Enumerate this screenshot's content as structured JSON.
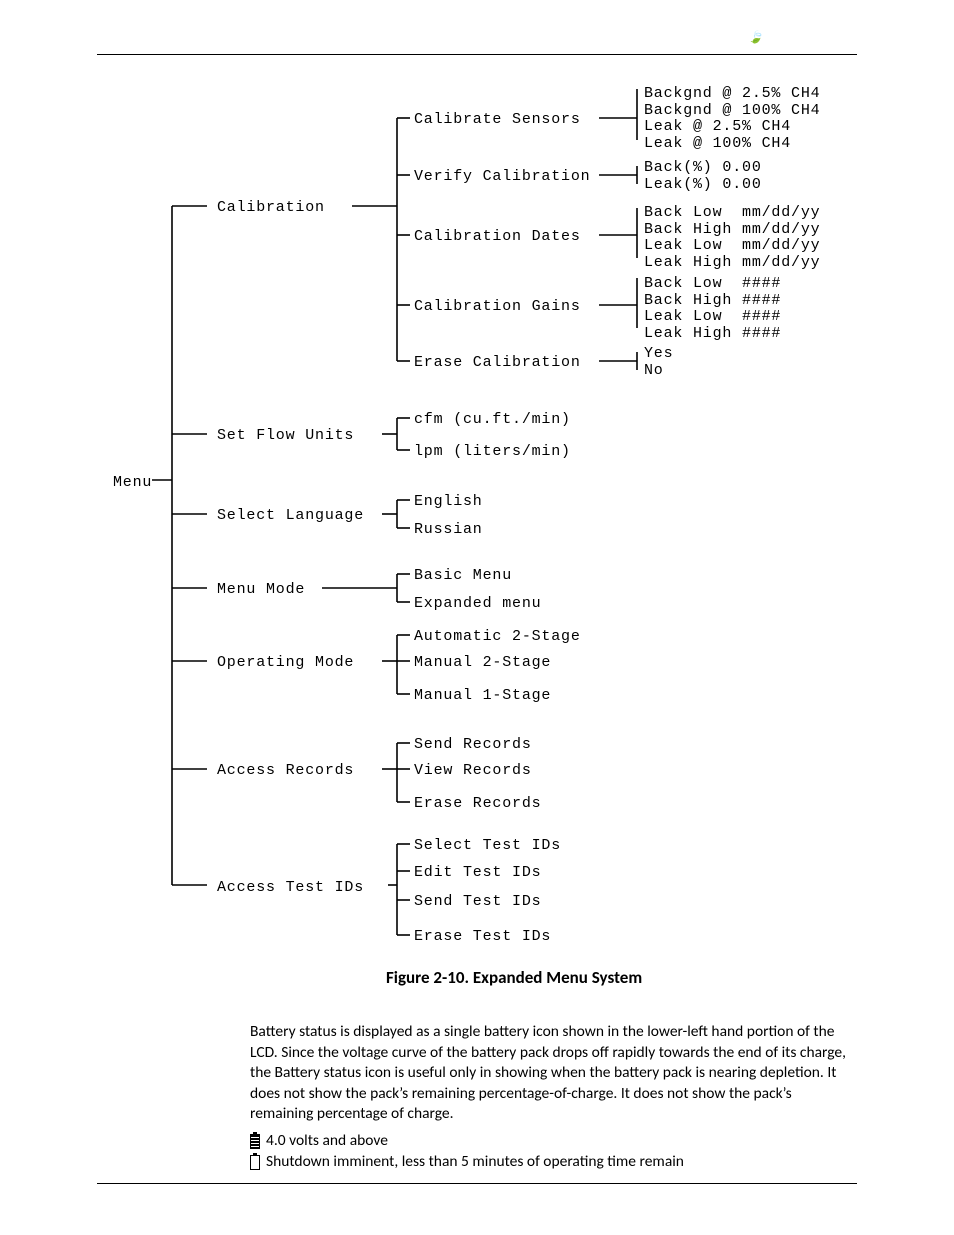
{
  "root_label": "Menu",
  "figure_caption": "Figure 2-10. Expanded Menu System",
  "paragraph": "Battery status is displayed as a single battery icon shown in the lower-left hand portion of the LCD. Since the voltage curve of the battery pack drops off rapidly towards the end of its charge, the Battery status icon is useful only in showing when the battery pack is nearing depletion. It does not show the pack’s remaining percentage-of-charge.   It does not show the pack’s remaining percentage of charge.",
  "batt_full_text": "4.0 volts and above",
  "batt_empty_text": "Shutdown imminent, less than 5 minutes of operating time remain",
  "col2": {
    "calibration": "Calibration",
    "set_flow_units": "Set Flow Units",
    "select_language": "Select Language",
    "menu_mode": "Menu Mode",
    "operating_mode": "Operating Mode",
    "access_records": "Access Records",
    "access_test_ids": "Access Test IDs"
  },
  "calib_items": {
    "calibrate_sensors": "Calibrate Sensors",
    "verify_calibration": "Verify Calibration",
    "calibration_dates": "Calibration Dates",
    "calibration_gains": "Calibration Gains",
    "erase_calibration": "Erase Calibration"
  },
  "calib_detail": {
    "sensors": "Backgnd @ 2.5% CH4\nBackgnd @ 100% CH4\nLeak @ 2.5% CH4\nLeak @ 100% CH4",
    "verify": "Back(%) 0.00\nLeak(%) 0.00",
    "dates": "Back Low  mm/dd/yy\nBack High mm/dd/yy\nLeak Low  mm/dd/yy\nLeak High mm/dd/yy",
    "gains": "Back Low  ####\nBack High ####\nLeak Low  ####\nLeak High ####",
    "erase": "Yes\nNo"
  },
  "flow_units": {
    "cfm": "cfm (cu.ft./min)",
    "lpm": "lpm (liters/min)"
  },
  "languages": {
    "english": "English",
    "russian": "Russian"
  },
  "menu_modes": {
    "basic": "Basic Menu",
    "expanded": "Expanded menu"
  },
  "op_modes": {
    "auto2": "Automatic 2-Stage",
    "man2": "Manual 2-Stage",
    "man1": "Manual 1-Stage"
  },
  "records": {
    "send": "Send Records",
    "view": "View Records",
    "erase": "Erase Records"
  },
  "test_ids": {
    "select": "Select Test IDs",
    "edit": "Edit Test IDs",
    "send": "Send Test IDs",
    "erase": "Erase Test IDs"
  }
}
